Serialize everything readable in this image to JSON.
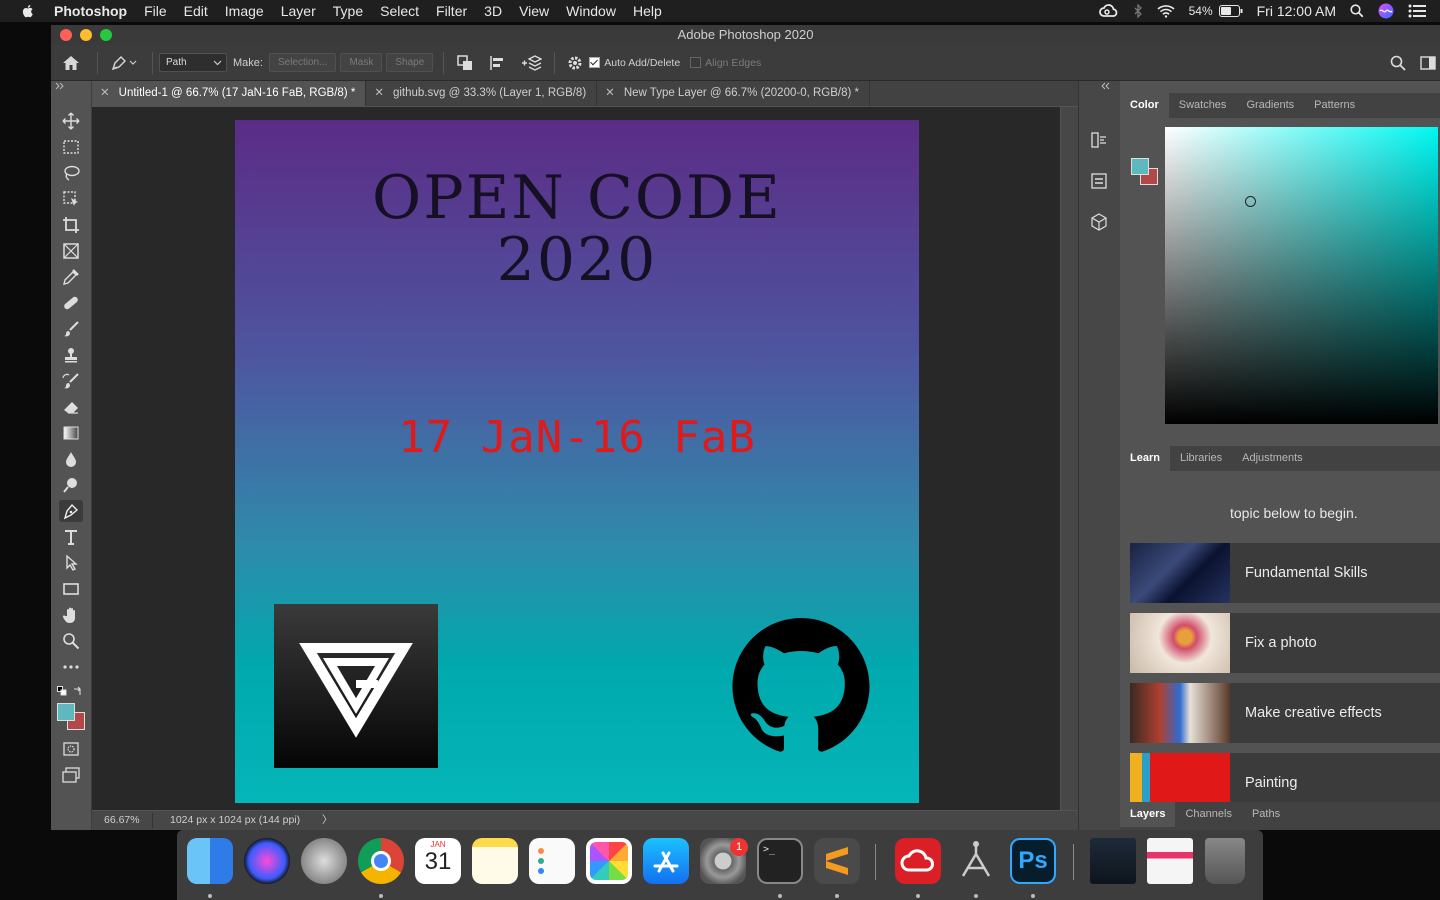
{
  "menubar": {
    "app_name": "Photoshop",
    "items": [
      "File",
      "Edit",
      "Image",
      "Layer",
      "Type",
      "Select",
      "Filter",
      "3D",
      "View",
      "Window",
      "Help"
    ],
    "battery": "54%",
    "clock": "Fri 12:00 AM"
  },
  "window": {
    "title": "Adobe Photoshop 2020"
  },
  "options_bar": {
    "mode_value": "Path",
    "make_label": "Make:",
    "selection_button": "Selection...",
    "mask_button": "Mask",
    "shape_button": "Shape",
    "auto_add_delete": "Auto Add/Delete",
    "align_edges": "Align Edges"
  },
  "doc_tabs": [
    {
      "label": "Untitled-1 @ 66.7% (17 JaN-16 FaB, RGB/8) *"
    },
    {
      "label": "github.svg @ 33.3% (Layer 1, RGB/8)"
    },
    {
      "label": "New Type Layer @ 66.7% (20200-0, RGB/8) *"
    }
  ],
  "document": {
    "title_line1": "OPEN CODE",
    "title_line2": "2020",
    "date_text": "17 JaN-16 FaB"
  },
  "status": {
    "zoom": "66.67%",
    "doc_info": "1024 px x 1024 px (144 ppi)",
    "arrow": "〉"
  },
  "color_panel": {
    "tabs": [
      "Color",
      "Swatches",
      "Gradients",
      "Patterns"
    ],
    "foreground": "#5fb8c0",
    "background": "#b34848",
    "hue_color": "#00f7f2"
  },
  "learn_panel": {
    "tabs": [
      "Learn",
      "Libraries",
      "Adjustments"
    ],
    "intro_text": "topic below to begin.",
    "items": [
      {
        "label": "Fundamental Skills"
      },
      {
        "label": "Fix a photo"
      },
      {
        "label": "Make creative effects"
      },
      {
        "label": "Painting"
      }
    ]
  },
  "layers_panel": {
    "tabs": [
      "Layers",
      "Channels",
      "Paths"
    ]
  },
  "dock": {
    "calendar_month": "JAN",
    "calendar_day": "31",
    "prefs_badge": "1",
    "ps_label": "Ps"
  }
}
